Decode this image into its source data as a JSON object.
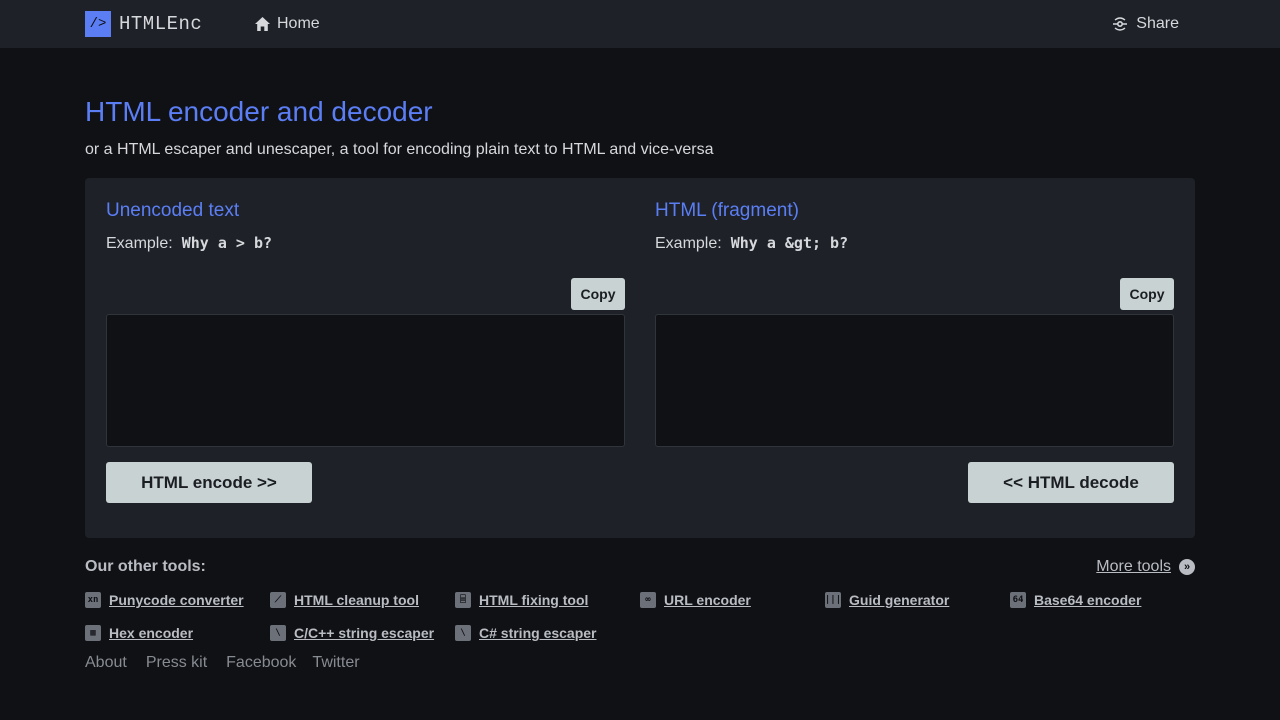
{
  "nav": {
    "logo_mark": "/>",
    "logo_text": "HTMLEnc",
    "home": "Home",
    "share": "Share"
  },
  "header": {
    "title": "HTML encoder and decoder",
    "subtitle": "or a HTML escaper and unescaper, a tool for encoding plain text to HTML and vice-versa"
  },
  "left": {
    "title": "Unencoded text",
    "example_label": "Example:",
    "example_value": "Why a > b?",
    "copy": "Copy",
    "value": "",
    "action": "HTML encode >>"
  },
  "right": {
    "title": "HTML (fragment)",
    "example_label": "Example:",
    "example_value": "Why a &gt; b?",
    "copy": "Copy",
    "value": "",
    "action": "<< HTML decode"
  },
  "tools": {
    "title": "Our other tools:",
    "more": "More tools",
    "items": [
      {
        "label": "Punycode converter",
        "icon": "punycode-icon",
        "glyph": "xn"
      },
      {
        "label": "HTML cleanup tool",
        "icon": "cleanup-icon",
        "glyph": "⟋"
      },
      {
        "label": "HTML fixing tool",
        "icon": "fixing-icon",
        "glyph": "⌸"
      },
      {
        "label": "URL encoder",
        "icon": "link-icon",
        "glyph": "∞"
      },
      {
        "label": "Guid generator",
        "icon": "barcode-icon",
        "glyph": "|||"
      },
      {
        "label": "Base64 encoder",
        "icon": "base64-icon",
        "glyph": "64"
      },
      {
        "label": "Hex encoder",
        "icon": "hex-icon",
        "glyph": "▦"
      },
      {
        "label": "C/C++ string escaper",
        "icon": "c-string-icon",
        "glyph": "\\"
      },
      {
        "label": "C# string escaper",
        "icon": "csharp-string-icon",
        "glyph": "\\"
      }
    ]
  },
  "footer": {
    "about": "About",
    "press": "Press kit",
    "facebook": "Facebook",
    "twitter": "Twitter"
  },
  "colors": {
    "accent": "#5b7ef5",
    "background": "#101115",
    "panel": "#1e2228",
    "button": "#c8d2d3"
  }
}
